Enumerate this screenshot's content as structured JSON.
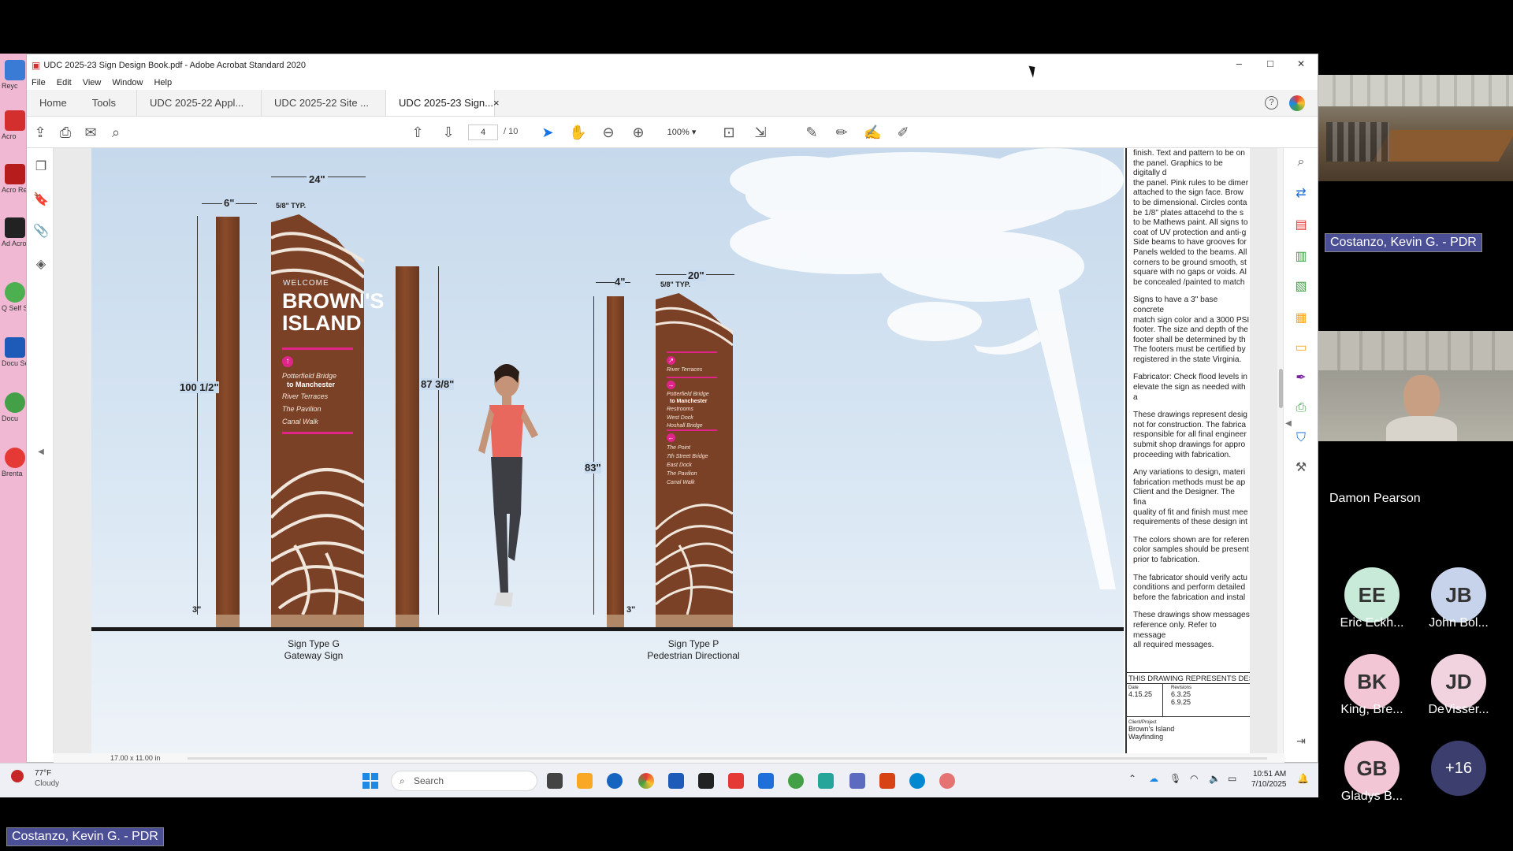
{
  "window": {
    "title": "UDC 2025-23 Sign Design Book.pdf - Adobe Acrobat Standard 2020",
    "minimize": "–",
    "maximize": "□",
    "close": "✕"
  },
  "menu": [
    "File",
    "Edit",
    "View",
    "Window",
    "Help"
  ],
  "tabs": [
    {
      "label": "Home"
    },
    {
      "label": "Tools"
    },
    {
      "label": "UDC 2025-22 Appl..."
    },
    {
      "label": "UDC 2025-22 Site ..."
    },
    {
      "label": "UDC 2025-23 Sign...",
      "active": true,
      "close": "×"
    }
  ],
  "toolbar": {
    "page_current": "4",
    "page_total": "/ 10",
    "zoom": "100%"
  },
  "drawing": {
    "dims": {
      "w24": "24\"",
      "w6": "6\"",
      "typ_g": "5/8\" TYP.",
      "h100": "100 1/2\"",
      "h87": "87 3/8\"",
      "w3a": "3\"",
      "w4": "4\"",
      "w20": "20\"",
      "typ_p": "5/8\" TYP.",
      "h83": "83\"",
      "w3b": "3\""
    },
    "sign_g": {
      "welcome": "WELCOME",
      "title1": "BROWN'S",
      "title2": "ISLAND",
      "line1": "Potterfield Bridge",
      "line2": "to Manchester",
      "line3": "River Terraces",
      "line4": "The Pavilion",
      "line5": "Canal Walk"
    },
    "sign_p": {
      "a1": "River Terraces",
      "b1": "Potterfield Bridge",
      "b2": "to Manchester",
      "b3": "Restrooms",
      "b4": "West Dock",
      "b5": "Hoshall Bridge",
      "c1": "The Point",
      "c2": "7th Street Bridge",
      "c3": "East Dock",
      "c4": "The Pavilion",
      "c5": "Canal Walk"
    },
    "caption_g1": "Sign Type G",
    "caption_g2": "Gateway Sign",
    "caption_p1": "Sign Type P",
    "caption_p2": "Pedestrian Directional"
  },
  "notes": [
    "finish. Text and pattern to be on\nthe panel. Graphics to be digitally d\nthe panel. Pink rules to be dimer\nattached to the sign face. Brow\nto be dimensional. Circles conta\nbe 1/8\" plates attacehd to the s\nto be Mathews paint. All signs to\ncoat of UV protection and anti-g\nSide beams to have grooves for\nPanels welded to the beams. All\ncorners to be ground smooth, st\nsquare with no gaps or voids. Al\nbe concealed /painted to match",
    "Signs to have a 3\" base concrete\nmatch sign color and a 3000 PSI\nfooter. The size and depth of the\nfooter shall be determined by th\nThe footers must be certified by\nregistered in the state Virginia.",
    "Fabricator: Check flood levels in\nelevate the sign as needed with a",
    "These drawings represent desig\nnot for construction. The fabrica\nresponsible for all final engineer\nsubmit shop drawings for appro\nproceeding with fabrication.",
    "Any variations to design, materi\nfabrication methods must be ap\nClient and the Designer. The fina\nquality of fit and finish must mee\nrequirements of these design int",
    "The colors shown are for referen\ncolor samples should be present\nprior to fabrication.",
    "The fabricator should verify actu\nconditions and perform detailed\nbefore the fabrication and instal",
    "These drawings show messages\nreference only. Refer to message\nall required messages."
  ],
  "titleblock": {
    "header": "THIS DRAWING REPRESENTS DESI",
    "date_label": "Date",
    "date": "4.15.25",
    "rev_label": "Revisions",
    "rev1": "6.3.25",
    "rev2": "6.9.25",
    "client_label": "Client/Project",
    "client1": "Brown's Island",
    "client2": "Wayfinding"
  },
  "status": {
    "page_size": "17.00 x 11.00 in"
  },
  "taskbar": {
    "temp": "77°F",
    "weather": "Cloudy",
    "search": "Search",
    "time": "10:51 AM",
    "date": "7/10/2025"
  },
  "desktop": {
    "labels": [
      "Reyc",
      "Acro",
      "Acro Re",
      "Ad Acrob",
      "Q Self S",
      "Docu Se",
      "Docu",
      "Brenta"
    ]
  },
  "meeting": {
    "presenter_tag": "Costanzo, Kevin G. - PDR",
    "video_tag": "Costanzo, Kevin G. - PDR",
    "speaker": "Damon Pearson",
    "participants": [
      {
        "initials": "EE",
        "name": "Eric Eckh...",
        "color": "#c8ead9"
      },
      {
        "initials": "JB",
        "name": "John Bol...",
        "color": "#c7d3ea"
      },
      {
        "initials": "BK",
        "name": "King, Bre...",
        "color": "#f3c6d6"
      },
      {
        "initials": "JD",
        "name": "DeVisser...",
        "color": "#f1d2df"
      },
      {
        "initials": "GB",
        "name": "Gladys B...",
        "color": "#f3c6d6"
      }
    ],
    "more": "+16"
  }
}
